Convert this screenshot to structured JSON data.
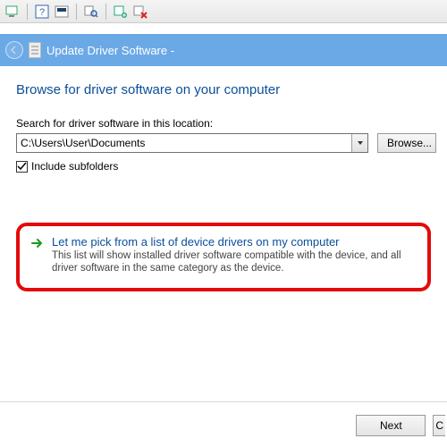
{
  "toolbar": {
    "icons": [
      "monitor-icon",
      "help-icon",
      "terminal-icon",
      "search-icon",
      "device-add-icon",
      "device-remove-icon"
    ]
  },
  "window": {
    "title": "Update Driver Software -"
  },
  "page": {
    "heading": "Browse for driver software on your computer",
    "search_label": "Search for driver software in this location:",
    "path_value": "C:\\Users\\User\\Documents",
    "browse_label": "Browse...",
    "include_subfolders_label": "Include subfolders",
    "include_subfolders_checked": true
  },
  "callout": {
    "title": "Let me pick from a list of device drivers on my computer",
    "desc": "This list will show installed driver software compatible with the device, and all driver software in the same category as the device."
  },
  "buttons": {
    "next": "Next",
    "cancel": "C"
  }
}
